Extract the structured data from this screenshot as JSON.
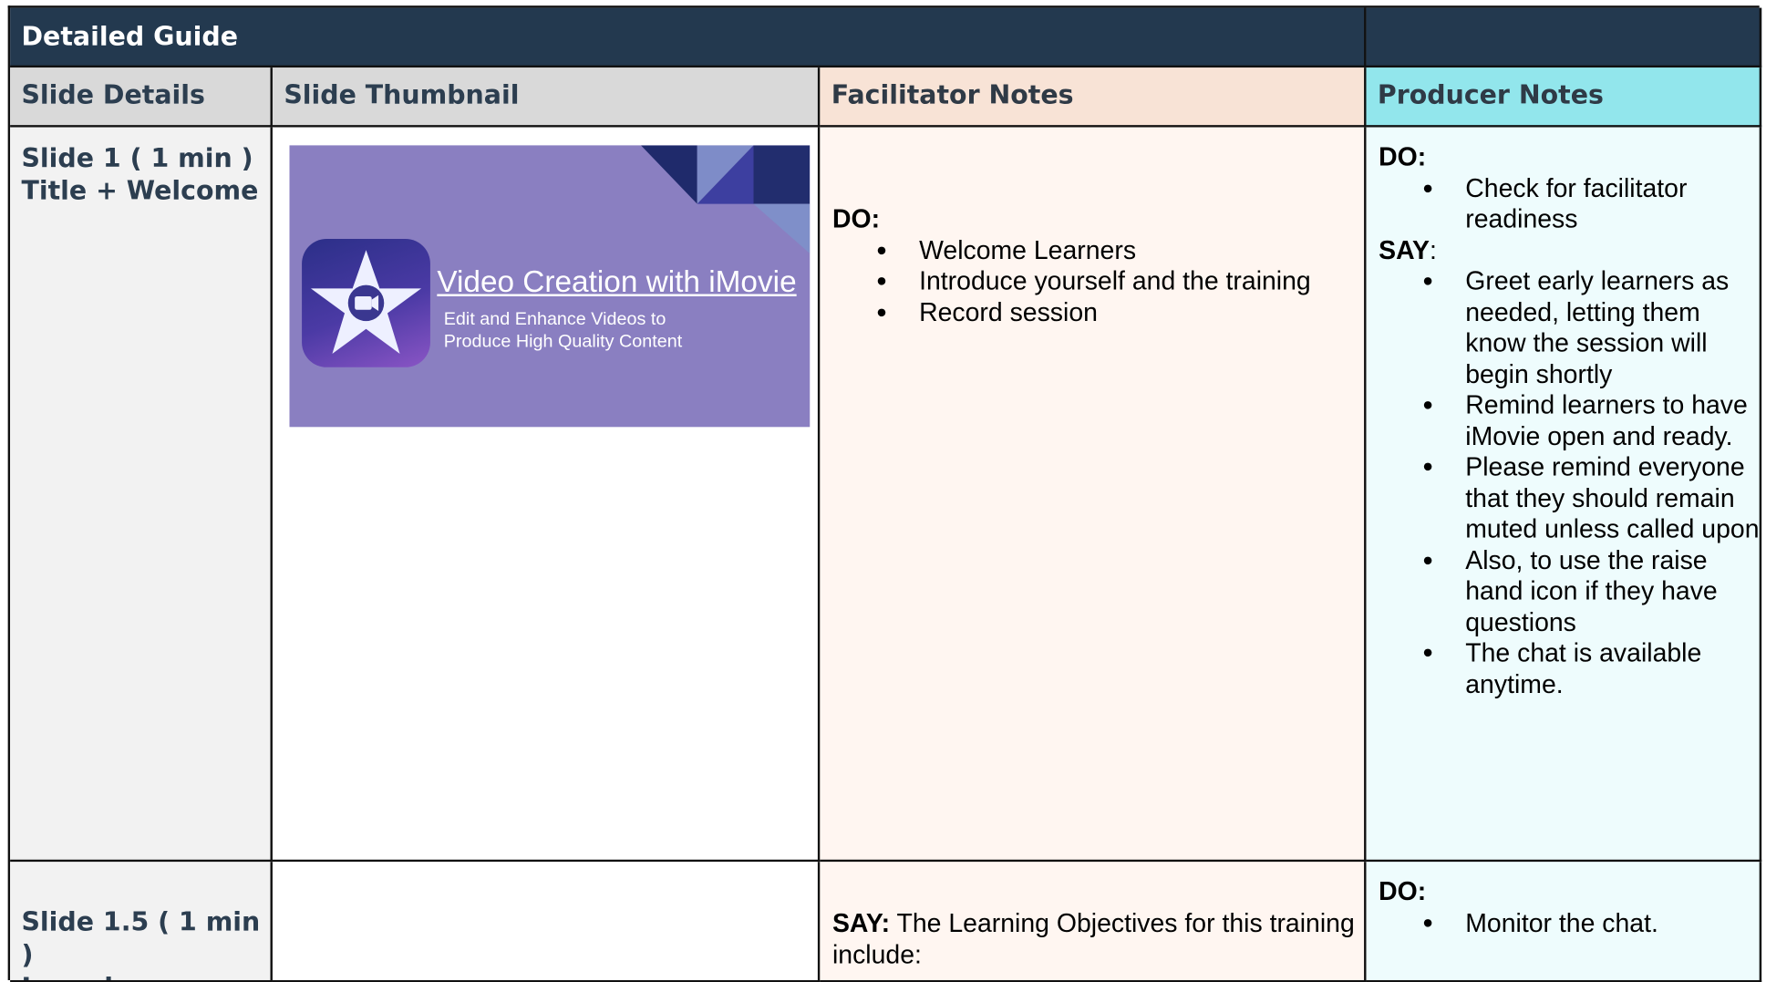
{
  "table": {
    "title": "Detailed Guide",
    "headers": {
      "slide_details": "Slide Details",
      "slide_thumbnail": "Slide Thumbnail",
      "facilitator_notes": "Facilitator Notes",
      "producer_notes": "Producer Notes"
    }
  },
  "colors": {
    "title_bar": "#23394f",
    "header_grey": "#d9d9d9",
    "header_peach": "#f8e3d6",
    "header_cyan": "#92e6ec",
    "thumbnail_bg": "#8a7fc1"
  },
  "rows": [
    {
      "slide_line1": "Slide 1 ( 1 min )",
      "slide_line2": "Title + Welcome",
      "thumbnail": {
        "title": "Video Creation with iMovie",
        "subtitle": "Edit and Enhance Videos to Produce High Quality Content",
        "icon": "imovie-star-icon"
      },
      "facilitator": {
        "do_label": "DO:",
        "do_items": [
          "Welcome Learners",
          "Introduce yourself and the training",
          "Record session"
        ]
      },
      "producer": {
        "do_label": "DO:",
        "do_items": [
          "Check for facilitator readiness"
        ],
        "say_label": "SAY",
        "say_colon": ":",
        "say_items": [
          "Greet early learners as needed, letting them know the session will begin shortly",
          "Remind learners to have iMovie open and ready.",
          "Please remind everyone that they should remain muted unless called upon",
          "Also, to use the raise hand icon if they have questions",
          "The chat is available anytime."
        ]
      }
    },
    {
      "slide_line1": "Slide 1.5 ( 1 min )",
      "slide_line2": "Learning",
      "facilitator": {
        "say_label": "SAY:",
        "say_text": " The Learning Objectives for this training include:"
      },
      "producer": {
        "do_label": "DO:",
        "do_items": [
          "Monitor the chat."
        ]
      }
    }
  ]
}
